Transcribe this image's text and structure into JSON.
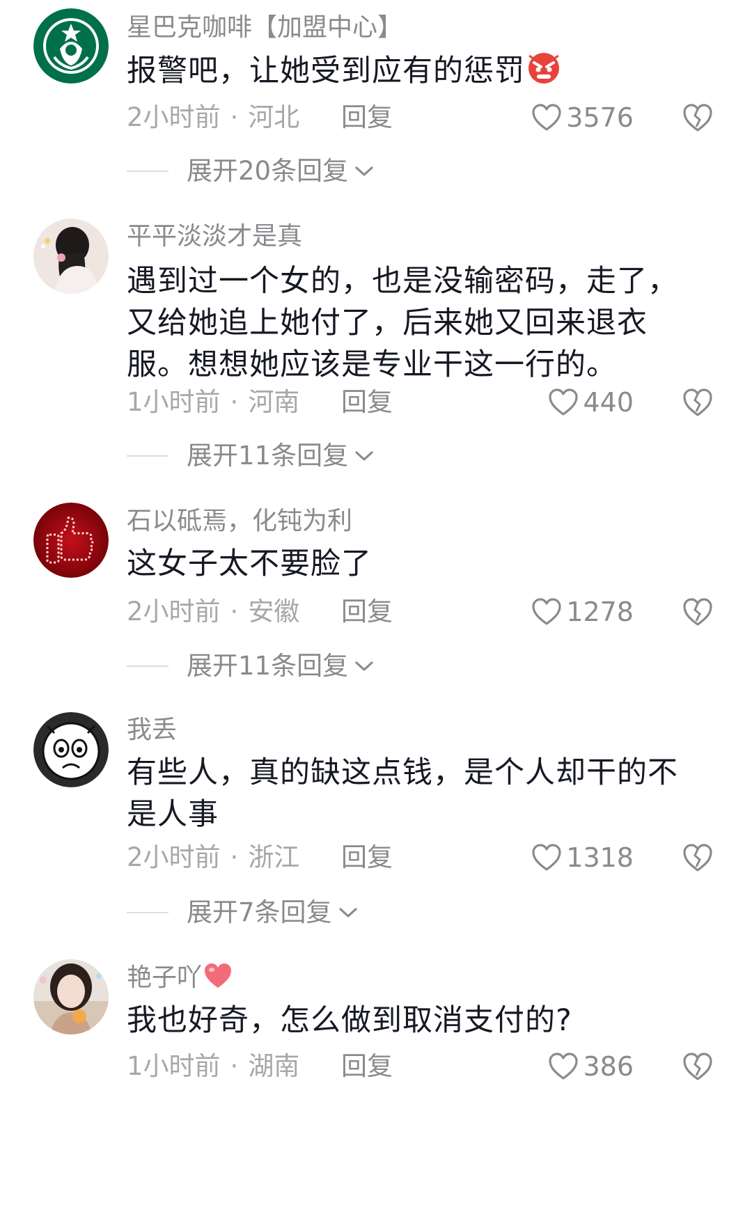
{
  "comments": [
    {
      "username": "星巴克咖啡【加盟中心】",
      "text": "报警吧，让她受到应有的惩罚",
      "time": "2小时前",
      "location": "河北",
      "reply_label": "回复",
      "likes": "3576",
      "expand_label": "展开20条回复",
      "text_emoji": "angry-face-emoji"
    },
    {
      "username": "平平淡淡才是真",
      "text": "遇到过一个女的，也是没输密码，走了，又给她追上她付了，后来她又回来退衣服。想想她应该是专业干这一行的。",
      "time": "1小时前",
      "location": "河南",
      "reply_label": "回复",
      "likes": "440",
      "expand_label": "展开11条回复"
    },
    {
      "username": "石以砥焉，化钝为利",
      "text": "这女子太不要脸了",
      "time": "2小时前",
      "location": "安徽",
      "reply_label": "回复",
      "likes": "1278",
      "expand_label": "展开11条回复"
    },
    {
      "username": "我丢",
      "text": "有些人，真的缺这点钱，是个人却干的不是人事",
      "time": "2小时前",
      "location": "浙江",
      "reply_label": "回复",
      "likes": "1318",
      "expand_label": "展开7条回复"
    },
    {
      "username": "艳子吖",
      "text": "我也好奇，怎么做到取消支付的?",
      "time": "1小时前",
      "location": "湖南",
      "reply_label": "回复",
      "likes": "386",
      "username_emoji": "heart-emoji"
    }
  ],
  "separator_dot": "·",
  "colors": {
    "meta_gray": "#a7a7ab",
    "name_gray": "#8a8a8e",
    "text_dark": "#161823",
    "starbucks_green": "#00704a",
    "emoji_red": "#e8433a"
  }
}
